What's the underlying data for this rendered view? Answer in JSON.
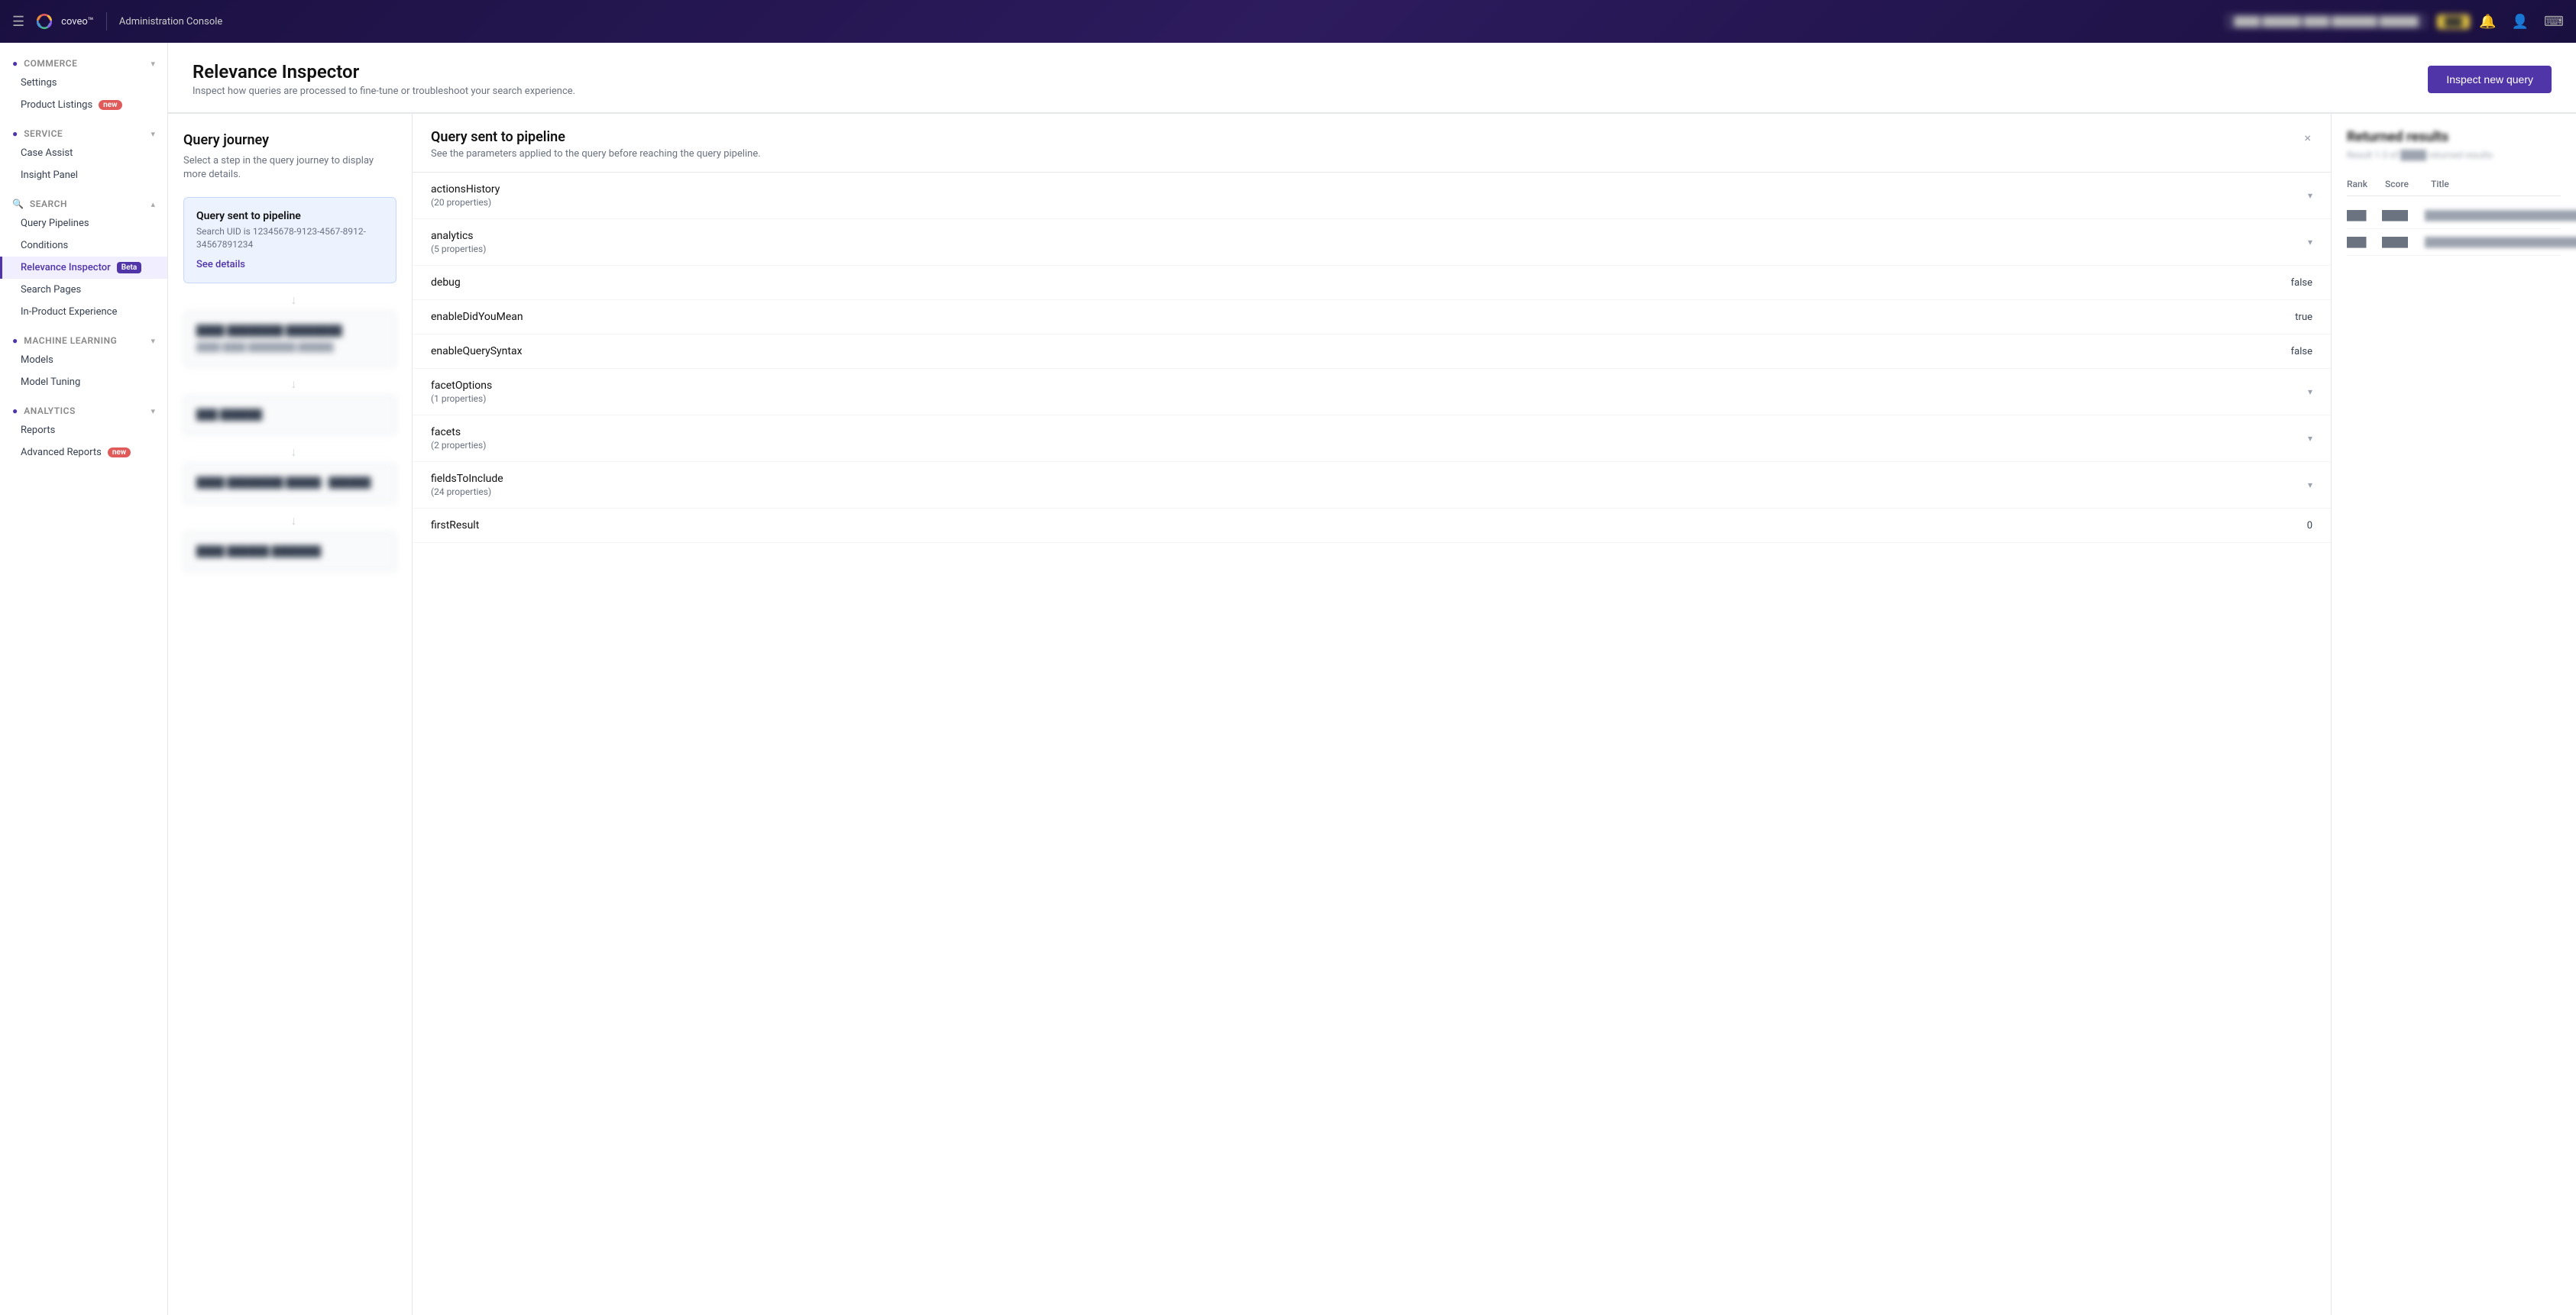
{
  "topnav": {
    "brand": "coveo™",
    "divider": "|",
    "console_label": "Administration Console",
    "org_label": "████ ██████ ████ ███████ ██████",
    "plan_badge": "███",
    "hamburger_icon": "☰",
    "bell_icon": "🔔",
    "user_icon": "👤",
    "terminal_icon": "⌨"
  },
  "sidebar": {
    "sections": [
      {
        "id": "commerce",
        "label": "Commerce",
        "items": [
          {
            "id": "settings",
            "label": "Settings",
            "badge": null
          },
          {
            "id": "product-listings",
            "label": "Product Listings",
            "badge": "new"
          }
        ]
      },
      {
        "id": "service",
        "label": "Service",
        "items": [
          {
            "id": "case-assist",
            "label": "Case Assist",
            "badge": null
          },
          {
            "id": "insight-panel",
            "label": "Insight Panel",
            "badge": null
          }
        ]
      },
      {
        "id": "search",
        "label": "Search",
        "items": [
          {
            "id": "query-pipelines",
            "label": "Query Pipelines",
            "badge": null
          },
          {
            "id": "conditions",
            "label": "Conditions",
            "badge": null
          },
          {
            "id": "relevance-inspector",
            "label": "Relevance Inspector",
            "badge": "Beta",
            "active": true
          },
          {
            "id": "search-pages",
            "label": "Search Pages",
            "badge": null
          },
          {
            "id": "in-product-experience",
            "label": "In-Product Experience",
            "badge": null
          }
        ]
      },
      {
        "id": "machine-learning",
        "label": "Machine Learning",
        "items": [
          {
            "id": "models",
            "label": "Models",
            "badge": null
          },
          {
            "id": "model-tuning",
            "label": "Model Tuning",
            "badge": null
          }
        ]
      },
      {
        "id": "analytics",
        "label": "Analytics",
        "items": [
          {
            "id": "reports",
            "label": "Reports",
            "badge": null
          },
          {
            "id": "advanced-reports",
            "label": "Advanced Reports",
            "badge": "new"
          }
        ]
      }
    ]
  },
  "page_header": {
    "title": "Relevance Inspector",
    "subtitle": "Inspect how queries are processed to fine-tune or troubleshoot your search experience.",
    "inspect_button": "Inspect new query"
  },
  "query_journey": {
    "title": "Query journey",
    "subtitle": "Select a step in the query journey to display more details.",
    "cards": [
      {
        "id": "query-sent",
        "title": "Query sent to pipeline",
        "subtitle": "Search UID is 12345678-9123-4567-8912-34567891234",
        "link": "See details",
        "highlighted": true
      },
      {
        "id": "blurred-1",
        "title": "████ ████████ ████████",
        "subtitle": "████ ████ ████████ ██████",
        "blurred": true
      },
      {
        "id": "blurred-2",
        "title": "███ ██████",
        "subtitle": "",
        "blurred": true
      },
      {
        "id": "blurred-3",
        "title": "████ ████████ █████ - ██████",
        "subtitle": "",
        "blurred": true
      },
      {
        "id": "blurred-4",
        "title": "████ ██████ ███████",
        "subtitle": "",
        "blurred": true
      }
    ]
  },
  "pipeline": {
    "title": "Query sent to pipeline",
    "subtitle": "See the parameters applied to the query before reaching the query pipeline.",
    "close_icon": "×",
    "rows": [
      {
        "id": "actionsHistory",
        "name": "actionsHistory",
        "props": "20 properties",
        "value": null,
        "expandable": true
      },
      {
        "id": "analytics",
        "name": "analytics",
        "props": "5 properties",
        "value": null,
        "expandable": true
      },
      {
        "id": "debug",
        "name": "debug",
        "props": null,
        "value": "false",
        "expandable": false
      },
      {
        "id": "enableDidYouMean",
        "name": "enableDidYouMean",
        "props": null,
        "value": "true",
        "expandable": false
      },
      {
        "id": "enableQuerySyntax",
        "name": "enableQuerySyntax",
        "props": null,
        "value": "false",
        "expandable": false
      },
      {
        "id": "facetOptions",
        "name": "facetOptions",
        "props": "1 properties",
        "value": null,
        "expandable": true
      },
      {
        "id": "facets",
        "name": "facets",
        "props": "2 properties",
        "value": null,
        "expandable": true
      },
      {
        "id": "fieldsToInclude",
        "name": "fieldsToInclude",
        "props": "24 properties",
        "value": null,
        "expandable": true
      },
      {
        "id": "firstResult",
        "name": "firstResult",
        "props": null,
        "value": "0",
        "expandable": false
      }
    ]
  },
  "results": {
    "title": "Returned results",
    "subtitle": "Result 1-3 of ████ returned results",
    "col_rank": "Rank",
    "col_score": "Score",
    "col_title": "Title",
    "rows": [
      {
        "rank": "███",
        "score": "████",
        "title": "███████████████████████████"
      },
      {
        "rank": "███",
        "score": "████",
        "title": "███████████████████████████"
      }
    ]
  }
}
